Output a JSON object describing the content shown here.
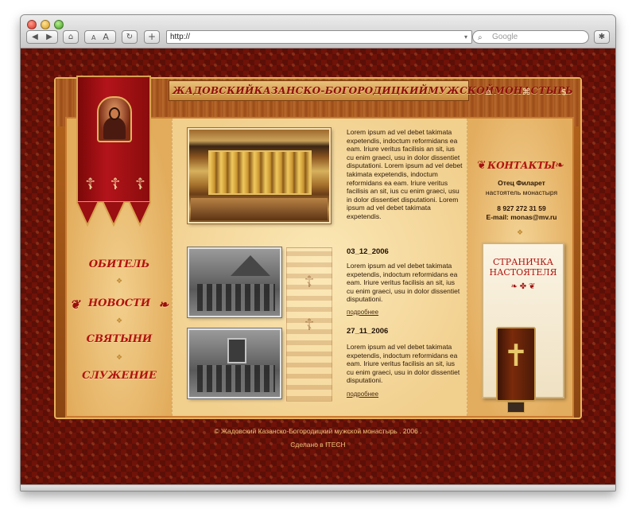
{
  "browser": {
    "url": "http://",
    "search_placeholder": "Google",
    "nav_back": "◀",
    "nav_forward": "▶",
    "text_small": "A",
    "text_large": "A",
    "home_glyph": "⌂",
    "reload_glyph": "↻",
    "add_glyph": "+",
    "bug_glyph": "✱",
    "dropdown_glyph": "▾",
    "search_glyph": "⌕"
  },
  "header": {
    "words": [
      "ЖАДОВСКИЙ",
      "КАЗАНСКО-БОГОРОДИЦКИЙ",
      "МУЖСКОЙ",
      "МОНАСТЫРЬ"
    ],
    "icons": [
      "⌂",
      "⌘",
      "$"
    ]
  },
  "banner": {
    "crosses": [
      "☦",
      "☦",
      "☦"
    ]
  },
  "nav": {
    "items": [
      "ОБИТЕЛЬ",
      "НОВОСТИ",
      "СВЯТЫНИ",
      "СЛУЖЕНИЕ"
    ],
    "separator": "❖",
    "active_deco_left": "❦",
    "active_deco_right": "❧"
  },
  "intro": {
    "text": "Lorem ipsum ad vel debet takimata expetendis, indoctum reformidans ea eam. Iriure veritus facilisis an sit, ius cu enim graeci, usu in dolor dissentiet disputationi. Lorem ipsum ad vel debet takimata expetendis, indoctum reformidans ea eam. Iriure veritus facilisis an sit, ius cu enim graeci, usu in dolor dissentiet disputationi. Lorem ipsum ad vel debet takimata expetendis."
  },
  "news": [
    {
      "date": "03_12_2006",
      "text": "Lorem ipsum ad vel debet takimata expetendis, indoctum reformidans ea eam. Iriure veritus facilisis an sit, ius cu enim graeci, usu in dolor dissentiet disputationi.",
      "more": "подробнее"
    },
    {
      "date": "27_11_2006",
      "text": "Lorem ipsum ad vel debet takimata expetendis, indoctum reformidans ea eam. Iriure veritus facilisis an sit, ius cu enim graeci, usu in dolor dissentiet disputationi.",
      "more": "подробнее"
    }
  ],
  "contacts": {
    "title": "КОНТАКТЫ",
    "deco_left": "❦",
    "deco_right": "❧",
    "name": "Отец Филарет",
    "role": "настоятель монастыря",
    "phone": "8 927 272 31 59",
    "email": "E-mail: monas@mv.ru",
    "separator": "❖"
  },
  "pastor": {
    "title_line1": "СТРАНИЧКА",
    "title_line2": "НАСТОЯТЕЛЯ",
    "ornament": "❧ ✤ ❦",
    "bible_cross": "✝"
  },
  "footer": {
    "copyright": "© Жадовский Казанско-Богородицкий мужской монастырь . 2006 .",
    "credit": "Сделано в ITECH"
  },
  "colors": {
    "accent_red": "#b1130f",
    "background_maroon": "#6f1208",
    "parchment": "#f1cf8d",
    "footer_text": "#f0c27a"
  }
}
